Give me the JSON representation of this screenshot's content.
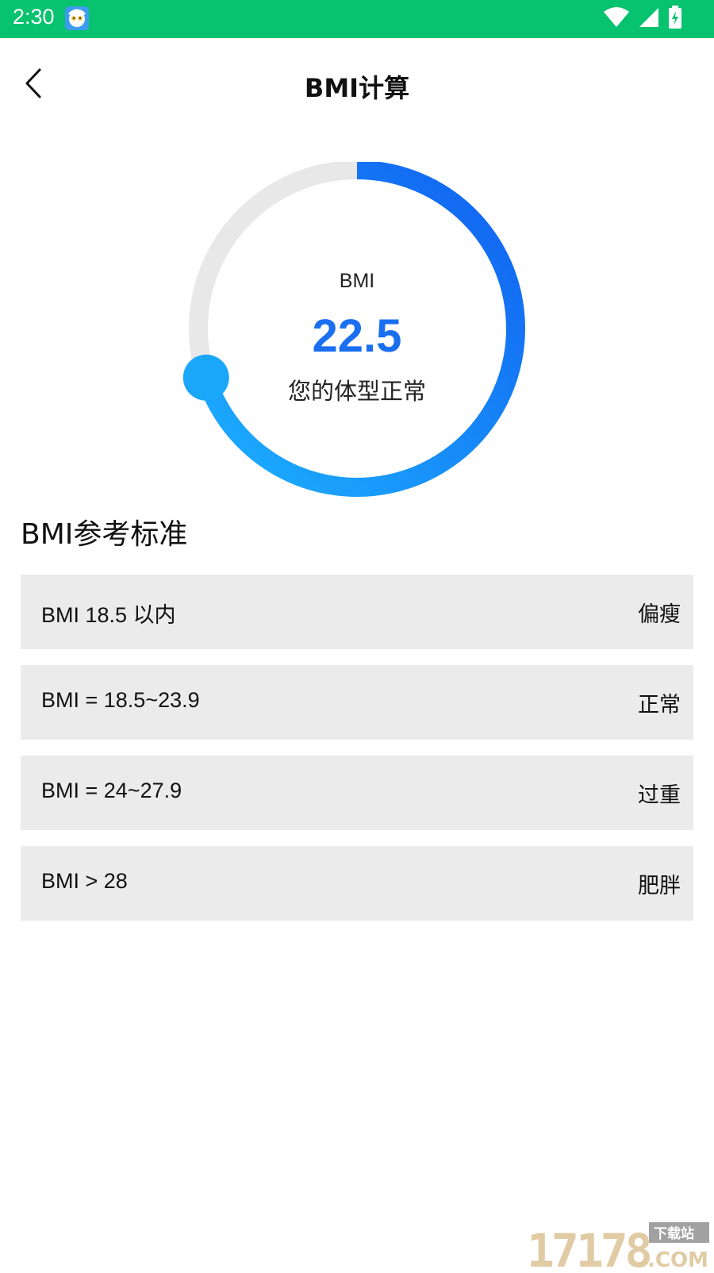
{
  "status_bar": {
    "time": "2:30",
    "color": "#07c26e"
  },
  "header": {
    "title": "BMI计算",
    "back_icon": "chevron-left-icon"
  },
  "gauge": {
    "label": "BMI",
    "value": "22.5",
    "status_text": "您的体型正常",
    "progress_fraction": 0.7,
    "accent_color": "#1a6ff0",
    "track_color": "#e8e8e8"
  },
  "reference": {
    "title": "BMI参考标准",
    "rows": [
      {
        "range": "BMI 18.5 以内",
        "category": "偏瘦"
      },
      {
        "range": "BMI = 18.5~23.9",
        "category": "正常"
      },
      {
        "range": "BMI = 24~27.9",
        "category": "过重"
      },
      {
        "range": "BMI > 28",
        "category": "肥胖"
      }
    ]
  },
  "watermark": {
    "digits": "17178",
    "suffix": "COM",
    "tag": "下载站"
  }
}
